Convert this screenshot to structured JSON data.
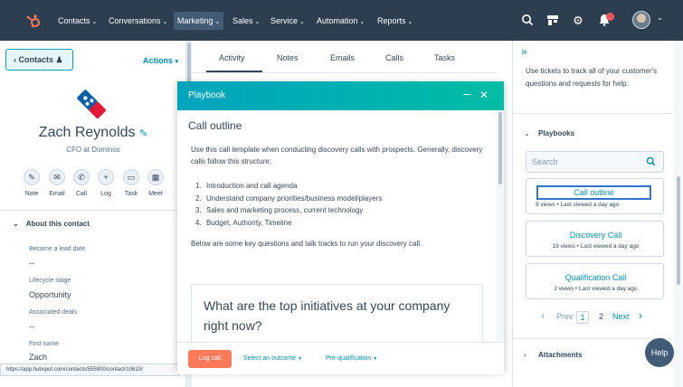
{
  "nav": {
    "items": [
      "Contacts",
      "Conversations",
      "Marketing",
      "Sales",
      "Service",
      "Automation",
      "Reports"
    ],
    "active": "Marketing",
    "icons": [
      "search-icon",
      "marketplace-icon",
      "settings-icon",
      "notifications-icon"
    ]
  },
  "contact": {
    "back_label": "Contacts",
    "actions_label": "Actions",
    "name": "Zach Reynolds",
    "title": "CFO at Dominos",
    "activity_actions": [
      "Note",
      "Email",
      "Call",
      "Log",
      "Task",
      "Meet"
    ],
    "about_header": "About this contact",
    "properties": [
      {
        "label": "Became a lead date",
        "value": "--"
      },
      {
        "label": "Lifecycle stage",
        "value": "Opportunity"
      },
      {
        "label": "Associated deals",
        "value": "--"
      },
      {
        "label": "First name",
        "value": "Zach"
      }
    ]
  },
  "status_url": "https://app.hubspot.com/contacts/555800/contact/10610/",
  "tabs": [
    "Activity",
    "Notes",
    "Emails",
    "Calls",
    "Tasks"
  ],
  "playbook": {
    "header": "Playbook",
    "heading": "Call outline",
    "intro": "Use this call template when conducting discovery calls with prospects. Generally, discovery calls follow this structure:",
    "steps": [
      "Introduction and call agenda",
      "Understand company priorities/business model/players",
      "Sales and marketing process, current technology",
      "Budget, Authority, Timeline"
    ],
    "after": "Below are some key questions and talk tracks to run your discovery call.",
    "question": "What are the top initiatives at your company right now?",
    "footer": {
      "log_call": "Log call",
      "outcome": "Select an outcome",
      "stage": "Pre-qualification"
    }
  },
  "right": {
    "tickets_text": "Use tickets to track all of your customer's questions and requests for help.",
    "playbooks_header": "Playbooks",
    "search_placeholder": "Search",
    "items": [
      {
        "title": "Call outline",
        "meta": "9 views • Last viewed a day ago"
      },
      {
        "title": "Discovery Call",
        "meta": "19 views • Last viewed a day ago"
      },
      {
        "title": "Qualification Call",
        "meta": "2 views • Last viewed a day ago"
      }
    ],
    "pager": {
      "prev": "Prev",
      "page1": "1",
      "page2": "2",
      "next": "Next"
    },
    "attachments_header": "Attachments",
    "help": "Help"
  },
  "colors": {
    "nav_bg": "#2d3e50",
    "accent_teal": "#00a4bd",
    "link": "#0091ae",
    "log_call": "#ff7a59"
  }
}
